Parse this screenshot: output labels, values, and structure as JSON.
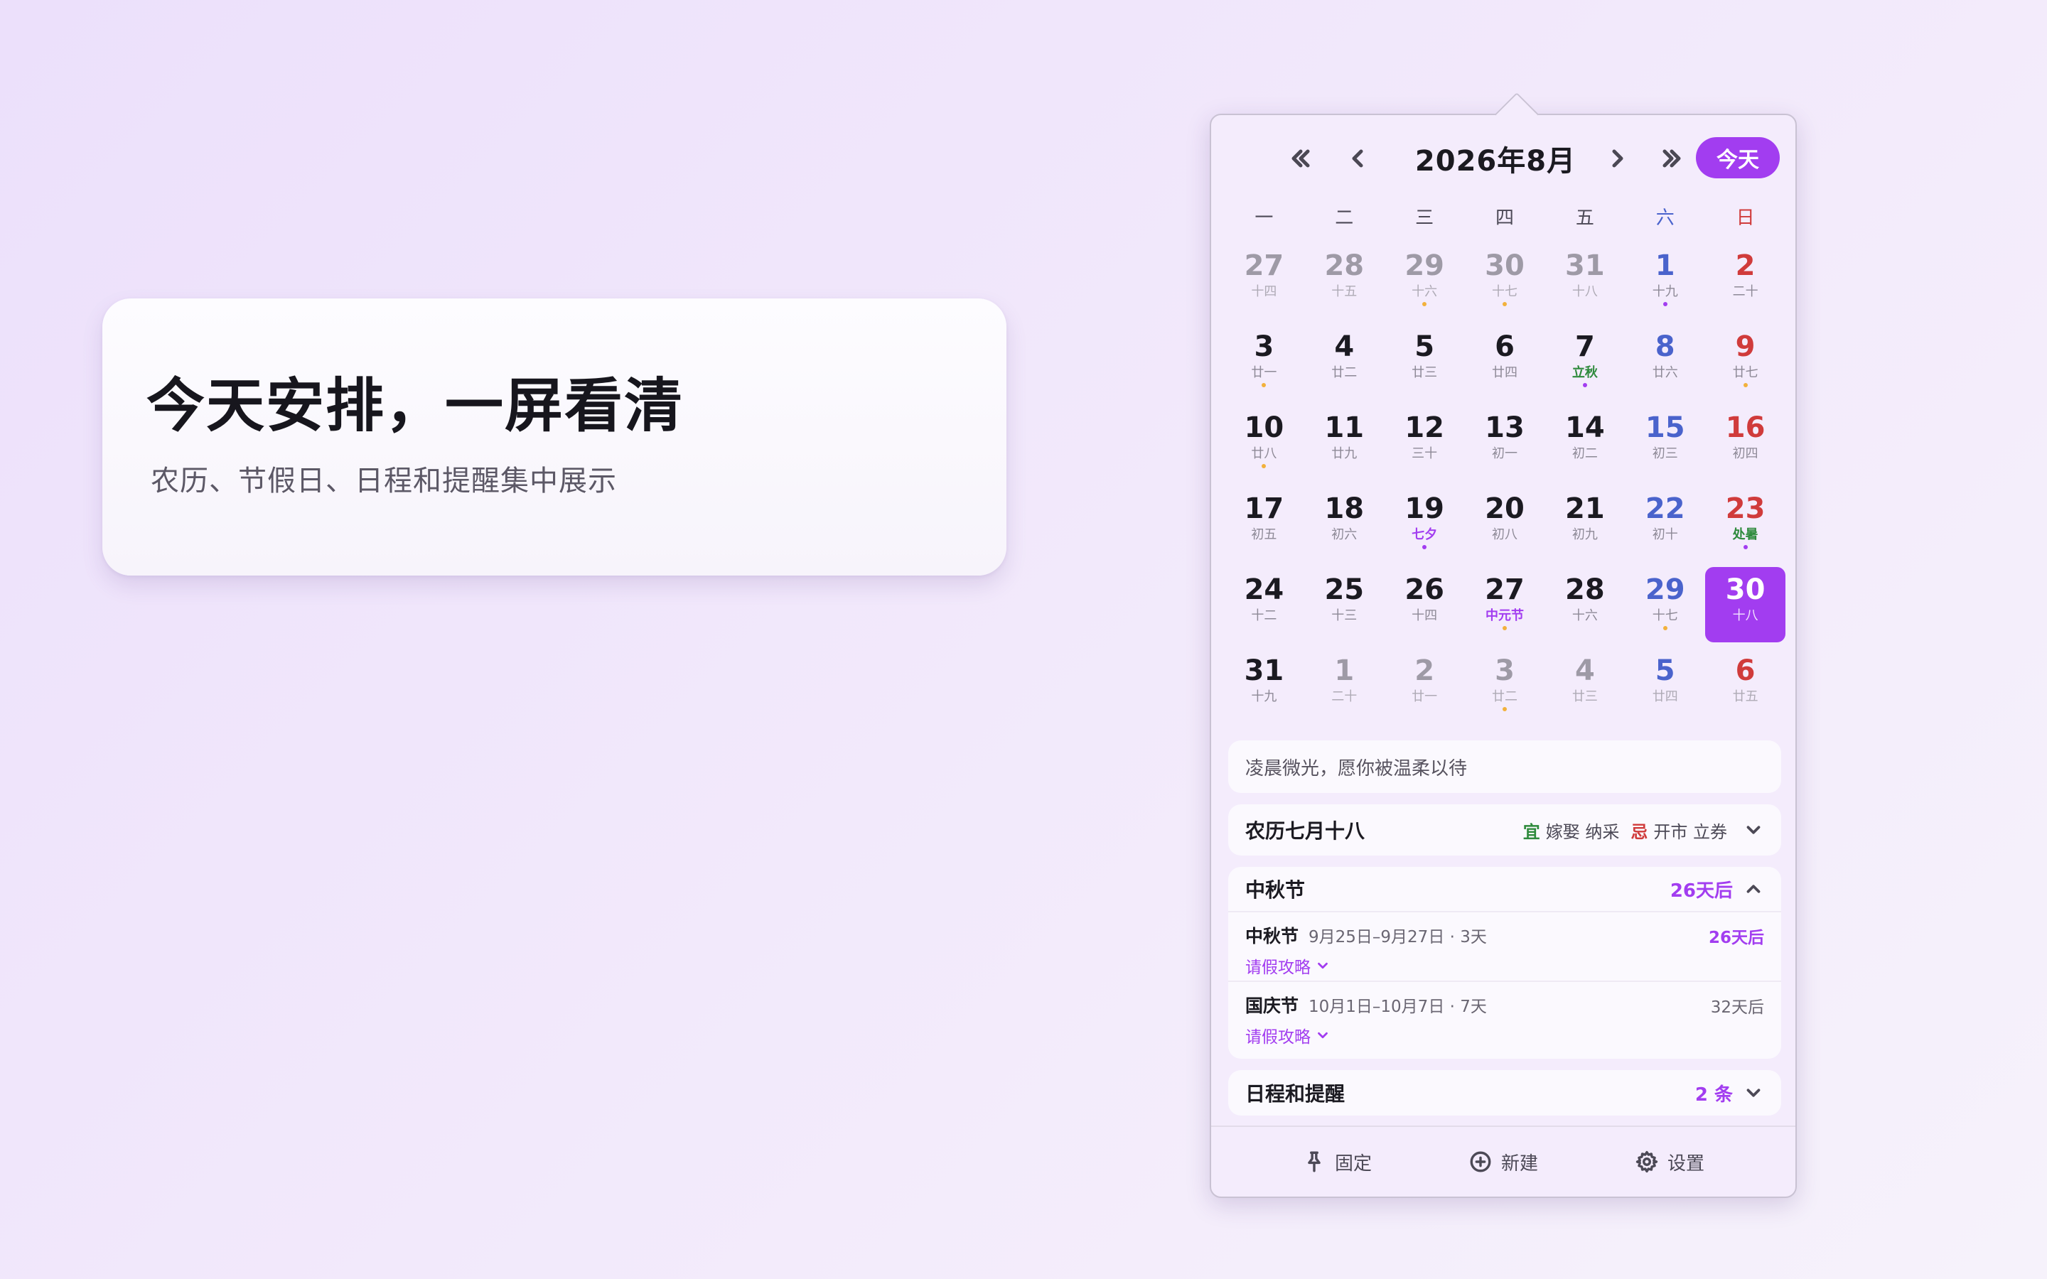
{
  "hero": {
    "title": "今天安排，一屏看清",
    "subtitle": "农历、节假日、日程和提醒集中展示"
  },
  "calendar": {
    "month_title": "2026年8月",
    "today_label": "今天",
    "weekdays": [
      "一",
      "二",
      "三",
      "四",
      "五",
      "六",
      "日"
    ],
    "colors": {
      "accent": "#a23df0",
      "saturday": "#4a63cc",
      "sunday": "#d03b3b",
      "solar_term": "#2e8a3c",
      "dot_orange": "#f2b13c",
      "dot_purple": "#a23df0"
    },
    "weeks": [
      [
        {
          "d": "27",
          "l": "十四",
          "other": true
        },
        {
          "d": "28",
          "l": "十五",
          "other": true
        },
        {
          "d": "29",
          "l": "十六",
          "other": true,
          "dot": "orange"
        },
        {
          "d": "30",
          "l": "十七",
          "other": true,
          "dot": "orange"
        },
        {
          "d": "31",
          "l": "十八",
          "other": true
        },
        {
          "d": "1",
          "l": "十九",
          "dot": "purple"
        },
        {
          "d": "2",
          "l": "二十"
        }
      ],
      [
        {
          "d": "3",
          "l": "廿一",
          "dot": "orange"
        },
        {
          "d": "4",
          "l": "廿二"
        },
        {
          "d": "5",
          "l": "廿三"
        },
        {
          "d": "6",
          "l": "廿四"
        },
        {
          "d": "7",
          "l": "立秋",
          "kind": "term",
          "dot": "purple"
        },
        {
          "d": "8",
          "l": "廿六"
        },
        {
          "d": "9",
          "l": "廿七",
          "dot": "orange"
        }
      ],
      [
        {
          "d": "10",
          "l": "廿八",
          "dot": "orange"
        },
        {
          "d": "11",
          "l": "廿九"
        },
        {
          "d": "12",
          "l": "三十"
        },
        {
          "d": "13",
          "l": "初一"
        },
        {
          "d": "14",
          "l": "初二"
        },
        {
          "d": "15",
          "l": "初三"
        },
        {
          "d": "16",
          "l": "初四"
        }
      ],
      [
        {
          "d": "17",
          "l": "初五"
        },
        {
          "d": "18",
          "l": "初六"
        },
        {
          "d": "19",
          "l": "七夕",
          "kind": "fest",
          "dot": "purple"
        },
        {
          "d": "20",
          "l": "初八"
        },
        {
          "d": "21",
          "l": "初九"
        },
        {
          "d": "22",
          "l": "初十"
        },
        {
          "d": "23",
          "l": "处暑",
          "kind": "term",
          "dot": "purple"
        }
      ],
      [
        {
          "d": "24",
          "l": "十二"
        },
        {
          "d": "25",
          "l": "十三"
        },
        {
          "d": "26",
          "l": "十四"
        },
        {
          "d": "27",
          "l": "中元节",
          "kind": "fest",
          "dot": "orange"
        },
        {
          "d": "28",
          "l": "十六"
        },
        {
          "d": "29",
          "l": "十七",
          "dot": "orange"
        },
        {
          "d": "30",
          "l": "十八",
          "selected": true
        }
      ],
      [
        {
          "d": "31",
          "l": "十九"
        },
        {
          "d": "1",
          "l": "二十",
          "other": true
        },
        {
          "d": "2",
          "l": "廿一",
          "other": true
        },
        {
          "d": "3",
          "l": "廿二",
          "other": true,
          "dot": "orange"
        },
        {
          "d": "4",
          "l": "廿三",
          "other": true
        },
        {
          "d": "5",
          "l": "廿四",
          "other": true
        },
        {
          "d": "6",
          "l": "廿五",
          "other": true
        }
      ]
    ]
  },
  "quote": "凌晨微光，愿你被温柔以待",
  "lunar_info": {
    "date": "农历七月十八",
    "yi_label": "宜",
    "yi_items": "嫁娶 纳采",
    "ji_label": "忌",
    "ji_items": "开市 立券"
  },
  "holidays": {
    "title": "中秋节",
    "countdown": "26天后",
    "items": [
      {
        "name": "中秋节",
        "range": "9月25日–9月27日 · 3天",
        "count": "26天后",
        "tip": "请假攻略"
      },
      {
        "name": "国庆节",
        "range": "10月1日–10月7日 · 7天",
        "count": "32天后",
        "tip": "请假攻略"
      }
    ]
  },
  "schedule": {
    "title": "日程和提醒",
    "count": "2 条"
  },
  "footer": {
    "pin_label": "固定",
    "new_label": "新建",
    "settings_label": "设置"
  },
  "icons": [
    "double-chevron-left-icon",
    "chevron-left-icon",
    "chevron-right-icon",
    "double-chevron-right-icon",
    "chevron-down-icon",
    "chevron-up-icon",
    "pin-icon",
    "plus-circle-icon",
    "gear-icon"
  ]
}
